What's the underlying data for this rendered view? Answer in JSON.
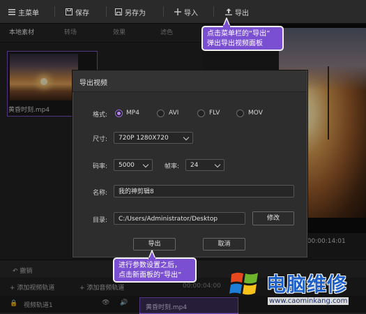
{
  "menubar": {
    "items": [
      {
        "label": "主菜单",
        "icon": "hamburger-icon"
      },
      {
        "label": "保存",
        "icon": "save-icon"
      },
      {
        "label": "另存为",
        "icon": "save-as-icon"
      },
      {
        "label": "导入",
        "icon": "plus-icon"
      },
      {
        "label": "导出",
        "icon": "upload-icon"
      }
    ]
  },
  "tabs": [
    "本地素材",
    "转场",
    "效果",
    "滤色"
  ],
  "media": {
    "clip_name": "黄昏时刻.mp4"
  },
  "preview": {
    "time": "0/00:00:14:01"
  },
  "timeline": {
    "add_video_track": "+ 添加视频轨道",
    "add_audio_track": "+ 添加音频轨道",
    "video_track_label": "视频轨道1",
    "clip_label": "黄昏时刻.mp4",
    "undo_label": "撤销",
    "time_mark": "00:00:04:00"
  },
  "dialog": {
    "title": "导出视频",
    "format_label": "格式:",
    "formats": [
      "MP4",
      "AVI",
      "FLV",
      "MOV"
    ],
    "selected_format": "MP4",
    "size_label": "尺寸:",
    "size_value": "720P 1280X720",
    "bitrate_label": "码率:",
    "bitrate_value": "5000",
    "framerate_label": "帧率:",
    "framerate_value": "24",
    "name_label": "名称:",
    "name_value": "我的神剪辑8",
    "dir_label": "目录:",
    "dir_value": "C:/Users/Administrator/Desktop",
    "modify_button": "修改",
    "export_button": "导出",
    "cancel_button": "取消"
  },
  "callouts": {
    "top_line1": "点击菜单栏的“导出”",
    "top_line2": "弹出导出视频面板",
    "bottom_line1": "进行参数设置之后，",
    "bottom_line2": "点击新面板的“导出”"
  },
  "watermark": {
    "title": "电脑维修",
    "url": "www.caominkang.com"
  },
  "colors": {
    "accent": "#7b4fd1",
    "selection": "#9b6ae6"
  }
}
